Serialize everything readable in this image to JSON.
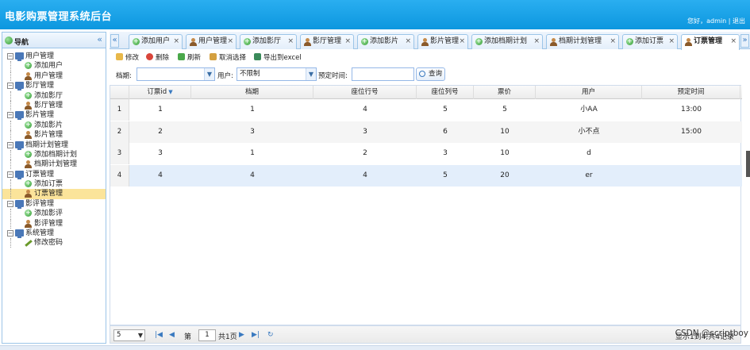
{
  "header": {
    "title": "电影购票管理系统后台",
    "user_text": "您好，admin | 退出"
  },
  "nav": {
    "title": "导航",
    "collapse_icon": "«",
    "groups": [
      {
        "label": "用户管理",
        "children": [
          {
            "label": "添加用户",
            "icon": "add-icon"
          },
          {
            "label": "用户管理",
            "icon": "person-icon"
          }
        ]
      },
      {
        "label": "影厅管理",
        "children": [
          {
            "label": "添加影厅",
            "icon": "add-icon"
          },
          {
            "label": "影厅管理",
            "icon": "person-icon"
          }
        ]
      },
      {
        "label": "影片管理",
        "children": [
          {
            "label": "添加影片",
            "icon": "add-icon"
          },
          {
            "label": "影片管理",
            "icon": "person-icon"
          }
        ]
      },
      {
        "label": "档期计划管理",
        "children": [
          {
            "label": "添加档期计划",
            "icon": "add-icon"
          },
          {
            "label": "档期计划管理",
            "icon": "person-icon"
          }
        ]
      },
      {
        "label": "订票管理",
        "children": [
          {
            "label": "添加订票",
            "icon": "add-icon"
          },
          {
            "label": "订票管理",
            "icon": "person-icon",
            "selected": true
          }
        ]
      },
      {
        "label": "影评管理",
        "children": [
          {
            "label": "添加影评",
            "icon": "add-icon"
          },
          {
            "label": "影评管理",
            "icon": "person-icon"
          }
        ]
      },
      {
        "label": "系统管理",
        "children": [
          {
            "label": "修改密码",
            "icon": "pencil-icon"
          }
        ]
      }
    ]
  },
  "tabs": {
    "scroll_left": "«",
    "scroll_right": "»",
    "close": "×",
    "items": [
      {
        "label": "添加用户",
        "icon": "add-icon"
      },
      {
        "label": "用户管理",
        "icon": "person-icon"
      },
      {
        "label": "添加影厅",
        "icon": "add-icon"
      },
      {
        "label": "影厅管理",
        "icon": "person-icon"
      },
      {
        "label": "添加影片",
        "icon": "add-icon"
      },
      {
        "label": "影片管理",
        "icon": "person-icon"
      },
      {
        "label": "添加档期计划",
        "icon": "add-icon"
      },
      {
        "label": "档期计划管理",
        "icon": "person-icon"
      },
      {
        "label": "添加订票",
        "icon": "add-icon"
      },
      {
        "label": "订票管理",
        "icon": "person-icon",
        "active": true
      }
    ]
  },
  "toolbar": {
    "edit": "修改",
    "delete": "删除",
    "refresh": "刷新",
    "unselect": "取消选择",
    "export": "导出到excel"
  },
  "filter": {
    "schedule_label": "档期:",
    "schedule_value": "",
    "user_label": "用户:",
    "user_value": "不限制",
    "time_label": "预定时间:",
    "time_value": "",
    "query_button": "查询"
  },
  "grid": {
    "columns": [
      "订票id",
      "档期",
      "座位行号",
      "座位列号",
      "票价",
      "用户",
      "预定时间"
    ],
    "sort_indicator": "▼",
    "rows": [
      {
        "n": "1",
        "cells": [
          "1",
          "1",
          "4",
          "5",
          "5",
          "小AA",
          "13:00"
        ]
      },
      {
        "n": "2",
        "cells": [
          "2",
          "3",
          "3",
          "6",
          "10",
          "小不点",
          "15:00"
        ]
      },
      {
        "n": "3",
        "cells": [
          "3",
          "1",
          "2",
          "3",
          "10",
          "d",
          ""
        ]
      },
      {
        "n": "4",
        "cells": [
          "4",
          "4",
          "4",
          "5",
          "20",
          "er",
          ""
        ]
      }
    ]
  },
  "pager": {
    "page_size": "5",
    "page_label": "第",
    "page_value": "1",
    "total_pages": "共1页",
    "info": "显示1到4,共4记录"
  },
  "watermark": "CSDN @scriptboy"
}
